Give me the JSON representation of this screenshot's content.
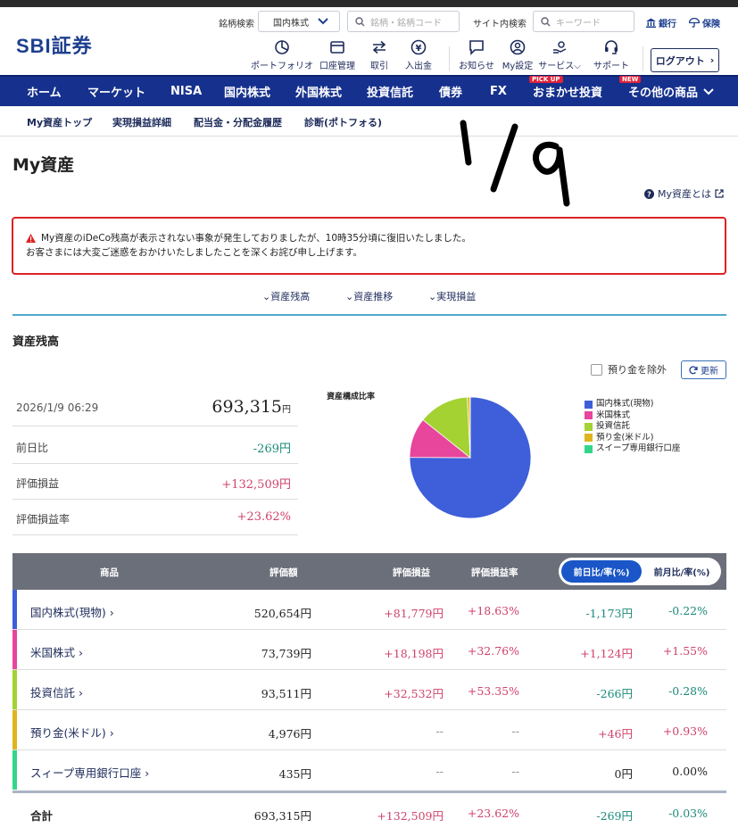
{
  "header": {
    "logo": "SBI証券",
    "stock_search_label": "銘柄検索",
    "stock_search_market": "国内株式",
    "stock_search_placeholder": "銘柄・銘柄コード",
    "site_search_label": "サイト内検索",
    "site_search_placeholder": "キーワード",
    "bank_link": "銀行",
    "insurance_link": "保険",
    "icons": [
      {
        "label": "ポートフォリオ",
        "icon": "portfolio-icon"
      },
      {
        "label": "口座管理",
        "icon": "account-icon"
      },
      {
        "label": "取引",
        "icon": "trade-icon"
      },
      {
        "label": "入出金",
        "icon": "deposit-icon"
      },
      {
        "label": "お知らせ",
        "icon": "notice-icon"
      },
      {
        "label": "My設定",
        "icon": "user-settings-icon"
      },
      {
        "label": "サービス",
        "icon": "service-icon"
      },
      {
        "label": "サポート",
        "icon": "support-icon"
      }
    ],
    "logout_label": "ログアウト"
  },
  "nav": {
    "items": [
      "ホーム",
      "マーケット",
      "NISA",
      "国内株式",
      "外国株式",
      "投資信託",
      "債券",
      "FX",
      "おまかせ投資",
      "その他の商品"
    ],
    "pickup_badge": "PICK UP",
    "new_badge": "NEW"
  },
  "subnav": {
    "items": [
      "My資産トップ",
      "実現損益詳細",
      "配当金・分配金履歴",
      "診断(ポトフォる)"
    ]
  },
  "handwritten_note": "1/9",
  "page_title": "My資産",
  "help_link": "My資産とは",
  "alert": {
    "line1": "My資産のiDeCo残高が表示されない事象が発生しておりましたが、10時35分頃に復旧いたしました。",
    "line2": "お客さまには大変ご迷惑をおかけいたしましたことを深くお詫び申し上げます。"
  },
  "anchors": [
    "資産残高",
    "資産推移",
    "実現損益"
  ],
  "section_title": "資産残高",
  "exclude_deposit_label": "預り金を除外",
  "refresh_label": "更新",
  "summary": {
    "datetime": "2026/1/9 06:29",
    "total": "693,315",
    "total_unit": "円",
    "rows": [
      {
        "label": "前日比",
        "value": "-269円"
      },
      {
        "label": "評価損益",
        "value": "+132,509円"
      },
      {
        "label": "評価損益率",
        "value": "+23.62%"
      }
    ]
  },
  "chart_data": {
    "type": "pie",
    "title": "資産構成比率",
    "categories": [
      "国内株式(現物)",
      "米国株式",
      "投資信託",
      "預り金(米ドル)",
      "スイープ専用銀行口座"
    ],
    "values": [
      520654,
      73739,
      93511,
      4976,
      435
    ],
    "colors": [
      "#3e5fd9",
      "#e8459c",
      "#a4d233",
      "#e0b41c",
      "#32d68a"
    ],
    "legend_position": "right"
  },
  "table": {
    "headers": [
      "商品",
      "評価額",
      "評価損益",
      "評価損益率"
    ],
    "toggle_on": "前日比/率(%)",
    "toggle_off": "前月比/率(%)",
    "rows": [
      {
        "name": "国内株式(現物)",
        "value": "520,654円",
        "pl": "+81,779円",
        "plr": "+18.63%",
        "dd": "-1,173円",
        "ddr": "-0.22%",
        "color": "#3e5fd9"
      },
      {
        "name": "米国株式",
        "value": "73,739円",
        "pl": "+18,198円",
        "plr": "+32.76%",
        "dd": "+1,124円",
        "ddr": "+1.55%",
        "color": "#e8459c"
      },
      {
        "name": "投資信託",
        "value": "93,511円",
        "pl": "+32,532円",
        "plr": "+53.35%",
        "dd": "-266円",
        "ddr": "-0.28%",
        "color": "#a4d233"
      },
      {
        "name": "預り金(米ドル)",
        "value": "4,976円",
        "pl": "--",
        "plr": "--",
        "dd": "+46円",
        "ddr": "+0.93%",
        "color": "#e0b41c"
      },
      {
        "name": "スィープ専用銀行口座",
        "value": "435円",
        "pl": "--",
        "plr": "--",
        "dd": "0円",
        "ddr": "0.00%",
        "color": "#32d68a"
      }
    ],
    "total": {
      "name": "合計",
      "value": "693,315円",
      "pl": "+132,509円",
      "plr": "+23.62%",
      "dd": "-269円",
      "ddr": "-0.03%"
    }
  }
}
